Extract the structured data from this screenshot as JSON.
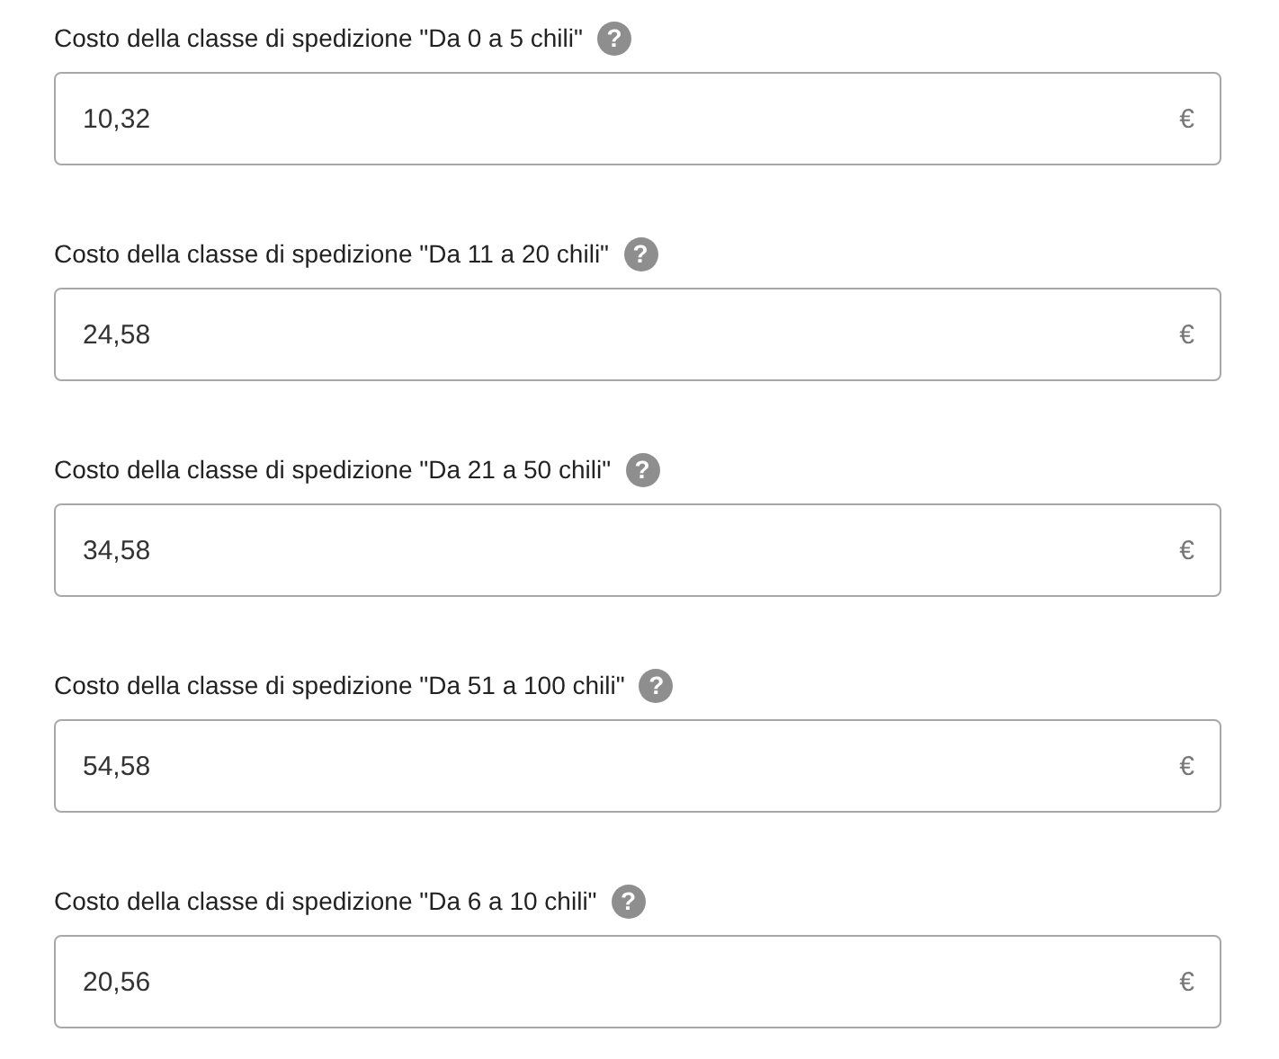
{
  "fields": [
    {
      "label": "Costo della classe di spedizione \"Da 0 a 5 chili\"",
      "help": "?",
      "value": "10,32",
      "currency": "€"
    },
    {
      "label": "Costo della classe di spedizione \"Da 11 a 20 chili\"",
      "help": "?",
      "value": "24,58",
      "currency": "€"
    },
    {
      "label": "Costo della classe di spedizione \"Da 21 a 50 chili\"",
      "help": "?",
      "value": "34,58",
      "currency": "€"
    },
    {
      "label": "Costo della classe di spedizione \"Da 51 a 100 chili\"",
      "help": "?",
      "value": "54,58",
      "currency": "€"
    },
    {
      "label": "Costo della classe di spedizione \"Da 6 a 10 chili\"",
      "help": "?",
      "value": "20,56",
      "currency": "€"
    }
  ]
}
